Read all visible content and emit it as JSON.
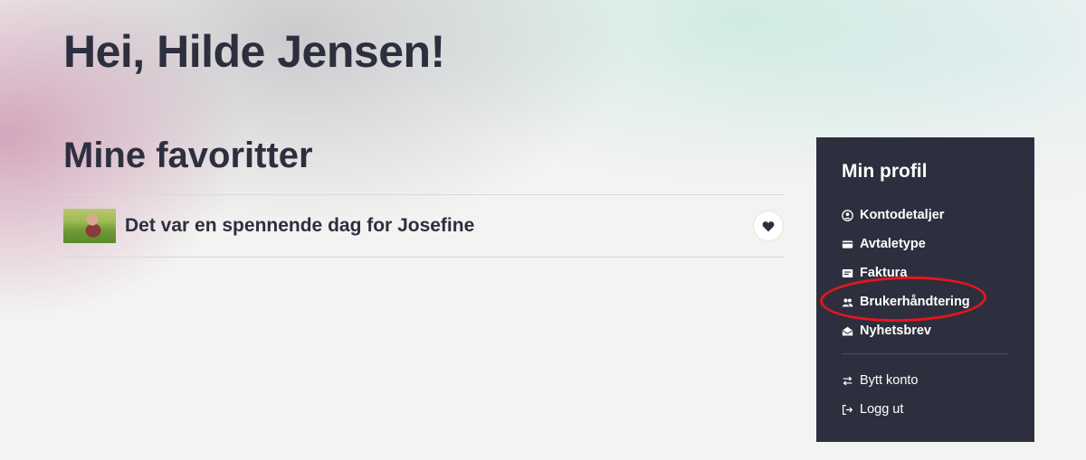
{
  "greeting": "Hei, Hilde Jensen!",
  "favorites": {
    "heading": "Mine favoritter",
    "items": [
      {
        "title": "Det var en spennende dag for Josefine",
        "thumbnail": "girl-in-meadow",
        "favorite_icon": "heart-icon"
      }
    ]
  },
  "profile": {
    "title": "Min profil",
    "menu": [
      {
        "label": "Kontodetaljer",
        "icon": "user-circle-icon"
      },
      {
        "label": "Avtaletype",
        "icon": "card-icon"
      },
      {
        "label": "Faktura",
        "icon": "invoice-icon"
      },
      {
        "label": "Brukerhåndtering",
        "icon": "users-icon",
        "highlighted": true
      },
      {
        "label": "Nyhetsbrev",
        "icon": "envelope-open-icon"
      }
    ],
    "secondary_menu": [
      {
        "label": "Bytt konto",
        "icon": "swap-icon"
      },
      {
        "label": "Logg ut",
        "icon": "logout-icon"
      }
    ]
  },
  "colors": {
    "panel_background": "#2e2f3e",
    "text_dark": "#2d2f3f",
    "highlight_ring": "#e5161b"
  }
}
